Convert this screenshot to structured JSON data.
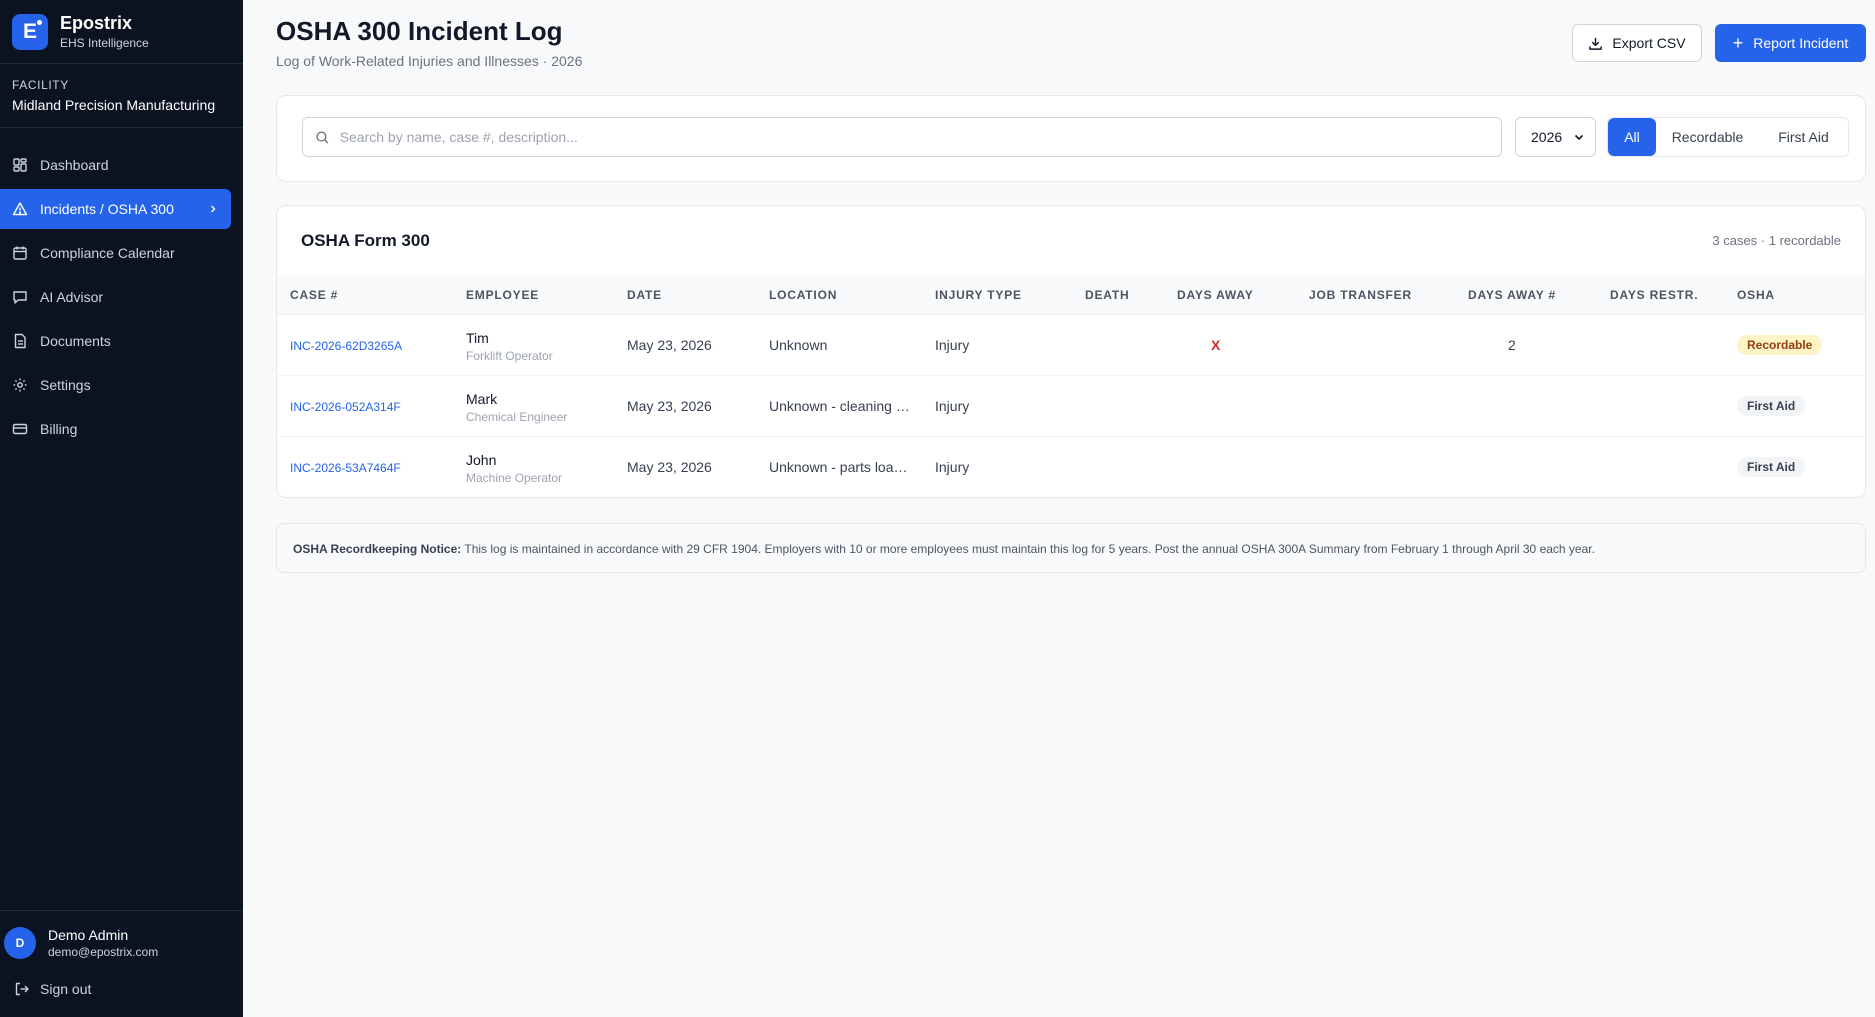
{
  "brand": {
    "name": "Epostrix",
    "subtitle": "EHS Intelligence",
    "logo_letter": "E"
  },
  "facility": {
    "label": "FACILITY",
    "name": "Midland Precision Manufacturing"
  },
  "nav": [
    {
      "label": "Dashboard",
      "icon": "grid-icon"
    },
    {
      "label": "Incidents / OSHA 300",
      "icon": "warning-icon",
      "active": true
    },
    {
      "label": "Compliance Calendar",
      "icon": "calendar-icon"
    },
    {
      "label": "AI Advisor",
      "icon": "chat-icon"
    },
    {
      "label": "Documents",
      "icon": "document-icon"
    },
    {
      "label": "Settings",
      "icon": "gear-icon"
    },
    {
      "label": "Billing",
      "icon": "credit-card-icon"
    }
  ],
  "user": {
    "initial": "D",
    "name": "Demo Admin",
    "email": "demo@epostrix.com",
    "signout_label": "Sign out"
  },
  "header": {
    "title": "OSHA 300 Incident Log",
    "subtitle": "Log of Work-Related Injuries and Illnesses · 2026",
    "export_label": "Export CSV",
    "report_label": "Report Incident"
  },
  "filters": {
    "search_placeholder": "Search by name, case #, description...",
    "year": "2026",
    "segments": [
      "All",
      "Recordable",
      "First Aid"
    ],
    "active_segment": "All"
  },
  "table": {
    "title": "OSHA Form 300",
    "count_text": "3 cases · 1 recordable",
    "columns": [
      "CASE #",
      "EMPLOYEE",
      "DATE",
      "LOCATION",
      "INJURY TYPE",
      "DEATH",
      "DAYS AWAY",
      "JOB TRANSFER",
      "DAYS AWAY #",
      "DAYS RESTR.",
      "OSHA"
    ],
    "rows": [
      {
        "case": "INC-2026-62D3265A",
        "employee": "Tim",
        "role": "Forklift Operator",
        "date": "May 23, 2026",
        "location": "Unknown",
        "injury_type": "Injury",
        "death": "",
        "days_away": "X",
        "job_transfer": "",
        "days_away_num": "2",
        "days_restr": "",
        "osha": "Recordable"
      },
      {
        "case": "INC-2026-052A314F",
        "employee": "Mark",
        "role": "Chemical Engineer",
        "date": "May 23, 2026",
        "location": "Unknown - cleaning …",
        "injury_type": "Injury",
        "death": "",
        "days_away": "",
        "job_transfer": "",
        "days_away_num": "",
        "days_restr": "",
        "osha": "First Aid"
      },
      {
        "case": "INC-2026-53A7464F",
        "employee": "John",
        "role": "Machine Operator",
        "date": "May 23, 2026",
        "location": "Unknown - parts loa…",
        "injury_type": "Injury",
        "death": "",
        "days_away": "",
        "job_transfer": "",
        "days_away_num": "",
        "days_restr": "",
        "osha": "First Aid"
      }
    ]
  },
  "notice": {
    "label": "OSHA Recordkeeping Notice:",
    "text": "This log is maintained in accordance with 29 CFR 1904. Employers with 10 or more employees must maintain this log for 5 years. Post the annual OSHA 300A Summary from February 1 through April 30 each year."
  },
  "colors": {
    "sidebar_bg": "#0b1220",
    "accent": "#2563eb",
    "danger": "#dc2626",
    "recordable_bg": "#fef3c7"
  }
}
